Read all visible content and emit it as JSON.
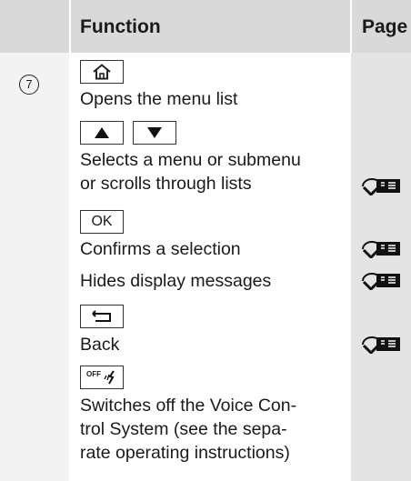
{
  "header": {
    "function": "Function",
    "page": "Page"
  },
  "item_number": "7",
  "keys": {
    "home_icon": "home-icon",
    "up_icon": "up-arrow-icon",
    "down_icon": "down-arrow-icon",
    "ok_label": "OK",
    "back_icon": "back-icon",
    "voice_off_label": "OFF"
  },
  "rows": {
    "opens_menu": "Opens the menu list",
    "selects_1": "Selects a menu or submenu",
    "selects_2": "or scrolls through lists",
    "confirms": "Confirms a selection",
    "hides": "Hides display messages",
    "back": "Back",
    "switch_1": "Switches off the Voice Con-",
    "switch_2": "trol System (see the sepa-",
    "switch_3": "rate operating instructions)"
  },
  "page_icon": "steering-wheel-book-icon"
}
